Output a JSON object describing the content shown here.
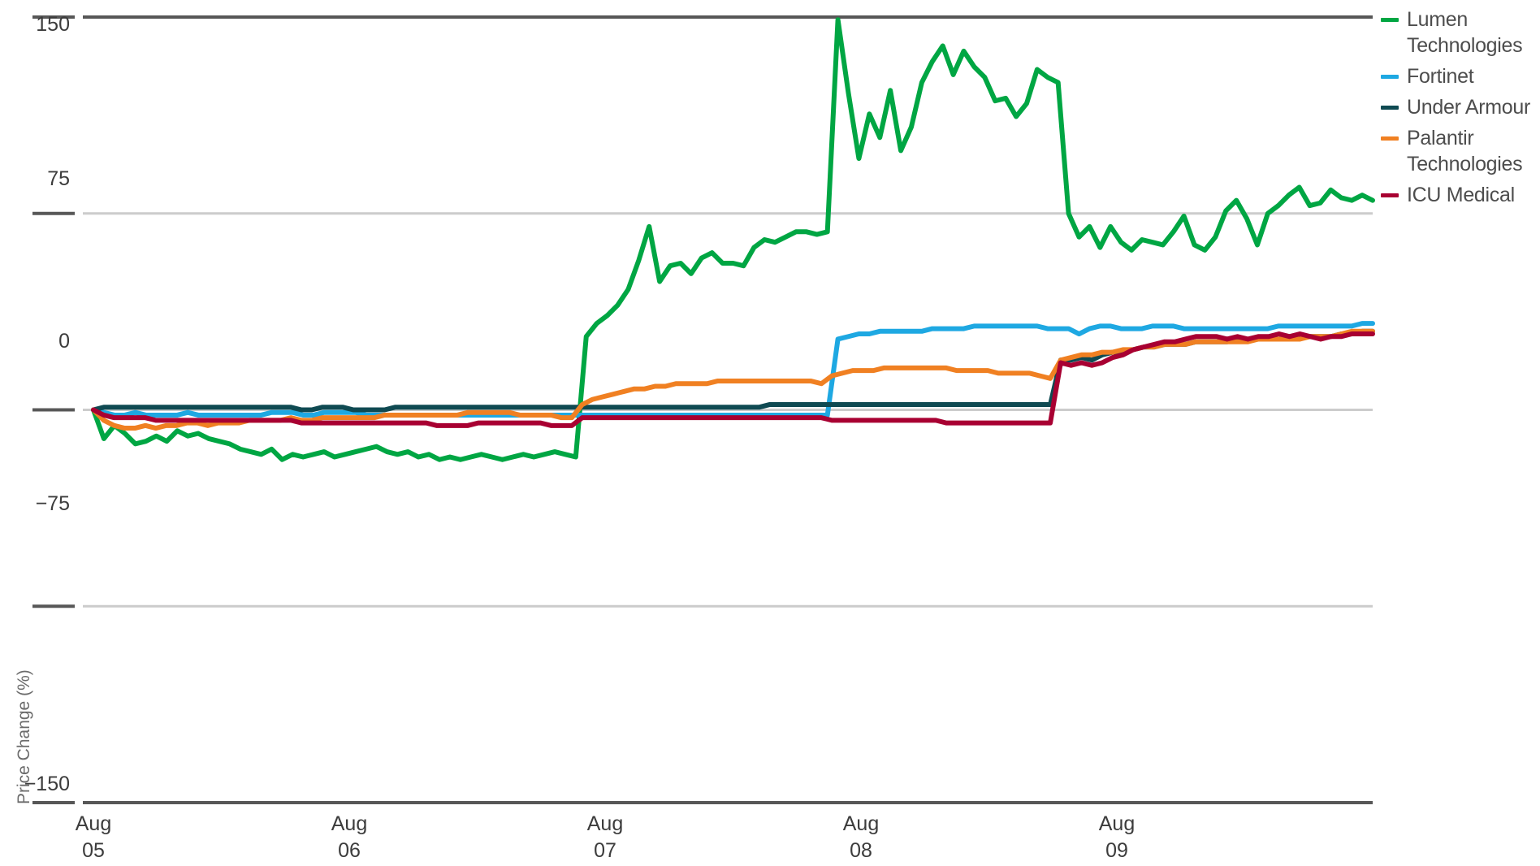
{
  "chart_data": {
    "type": "line",
    "title": "",
    "xlabel": "",
    "ylabel": "Price Change (%)",
    "ylim": [
      -150,
      150
    ],
    "yticks": [
      150,
      75,
      0,
      -75,
      -150
    ],
    "ytick_labels": [
      "150",
      "75",
      "0",
      "−75",
      "−150"
    ],
    "grid": "horizontal-light",
    "legend_position": "right",
    "x_tick_labels": [
      {
        "line1": "Aug",
        "line2": "05"
      },
      {
        "line1": "Aug",
        "line2": "06"
      },
      {
        "line1": "Aug",
        "line2": "07"
      },
      {
        "line1": "Aug",
        "line2": "08"
      },
      {
        "line1": "Aug",
        "line2": "09"
      }
    ],
    "x_start": "Aug 05",
    "x_end": "Aug 09",
    "series": [
      {
        "name": "Lumen Technologies",
        "color": "#00A643",
        "values": [
          0,
          -11,
          -6,
          -9,
          -13,
          -12,
          -10,
          -12,
          -8,
          -10,
          -9,
          -11,
          -12,
          -13,
          -15,
          -16,
          -17,
          -15,
          -19,
          -17,
          -18,
          -17,
          -16,
          -18,
          -17,
          -16,
          -15,
          -14,
          -16,
          -17,
          -16,
          -18,
          -17,
          -19,
          -18,
          -19,
          -18,
          -17,
          -18,
          -19,
          -18,
          -17,
          -18,
          -17,
          -16,
          -17,
          -18,
          28,
          33,
          36,
          40,
          46,
          57,
          70,
          49,
          55,
          56,
          52,
          58,
          60,
          56,
          56,
          55,
          62,
          65,
          64,
          66,
          68,
          68,
          67,
          68,
          149,
          121,
          96,
          113,
          104,
          122,
          99,
          108,
          125,
          133,
          139,
          128,
          137,
          131,
          127,
          118,
          119,
          112,
          117,
          130,
          127,
          125,
          75,
          66,
          70,
          62,
          70,
          64,
          61,
          65,
          64,
          63,
          68,
          74,
          63,
          61,
          66,
          76,
          80,
          73,
          63,
          75,
          78,
          82,
          85,
          78,
          79,
          84,
          81,
          80,
          82,
          80
        ]
      },
      {
        "name": "Fortinet",
        "color": "#1EA8E2",
        "values": [
          0,
          -1,
          -2,
          -2,
          -1,
          -2,
          -2,
          -2,
          -2,
          -1,
          -2,
          -2,
          -2,
          -2,
          -2,
          -2,
          -2,
          -1,
          -1,
          -1,
          -2,
          -2,
          -1,
          -1,
          -1,
          -1,
          -2,
          -2,
          -2,
          -2,
          -2,
          -2,
          -2,
          -2,
          -2,
          -2,
          -2,
          -2,
          -2,
          -2,
          -2,
          -2,
          -2,
          -2,
          -2,
          -2,
          -2,
          -2,
          -2,
          -2,
          -2,
          -2,
          -2,
          -2,
          -2,
          -2,
          -2,
          -2,
          -2,
          -2,
          -2,
          -2,
          -2,
          -2,
          -2,
          -2,
          -2,
          -2,
          -2,
          -2,
          -2,
          27,
          28,
          29,
          29,
          30,
          30,
          30,
          30,
          30,
          31,
          31,
          31,
          31,
          32,
          32,
          32,
          32,
          32,
          32,
          32,
          31,
          31,
          31,
          29,
          31,
          32,
          32,
          31,
          31,
          31,
          32,
          32,
          32,
          31,
          31,
          31,
          31,
          31,
          31,
          31,
          31,
          31,
          32,
          32,
          32,
          32,
          32,
          32,
          32,
          32,
          33,
          33
        ]
      },
      {
        "name": "Under Armour",
        "color": "#0F4A52",
        "values": [
          0,
          1,
          1,
          1,
          1,
          1,
          1,
          1,
          1,
          1,
          1,
          1,
          1,
          1,
          1,
          1,
          1,
          1,
          1,
          1,
          0,
          0,
          1,
          1,
          1,
          0,
          0,
          0,
          0,
          1,
          1,
          1,
          1,
          1,
          1,
          1,
          1,
          1,
          1,
          1,
          1,
          1,
          1,
          1,
          1,
          1,
          1,
          1,
          1,
          1,
          1,
          1,
          1,
          1,
          1,
          1,
          1,
          1,
          1,
          1,
          1,
          1,
          1,
          1,
          1,
          2,
          2,
          2,
          2,
          2,
          2,
          2,
          2,
          2,
          2,
          2,
          2,
          2,
          2,
          2,
          2,
          2,
          2,
          2,
          2,
          2,
          2,
          2,
          2,
          2,
          2,
          2,
          2,
          19,
          19,
          20,
          19,
          21,
          22,
          22,
          23,
          24,
          24,
          25,
          25,
          25,
          26,
          26,
          26,
          26,
          27,
          27,
          27,
          27,
          27,
          28,
          28,
          28,
          28,
          28,
          29,
          29,
          30,
          30
        ]
      },
      {
        "name": "Palantir Technologies",
        "color": "#F08022",
        "values": [
          0,
          -4,
          -6,
          -7,
          -7,
          -6,
          -7,
          -6,
          -6,
          -5,
          -5,
          -6,
          -5,
          -5,
          -5,
          -4,
          -4,
          -4,
          -4,
          -3,
          -4,
          -4,
          -3,
          -3,
          -3,
          -3,
          -3,
          -3,
          -2,
          -2,
          -2,
          -2,
          -2,
          -2,
          -2,
          -2,
          -1,
          -1,
          -1,
          -1,
          -1,
          -2,
          -2,
          -2,
          -2,
          -3,
          -3,
          2,
          4,
          5,
          6,
          7,
          8,
          8,
          9,
          9,
          10,
          10,
          10,
          10,
          11,
          11,
          11,
          11,
          11,
          11,
          11,
          11,
          11,
          11,
          10,
          13,
          14,
          15,
          15,
          15,
          16,
          16,
          16,
          16,
          16,
          16,
          16,
          15,
          15,
          15,
          15,
          14,
          14,
          14,
          14,
          13,
          12,
          19,
          20,
          21,
          21,
          22,
          22,
          23,
          23,
          24,
          24,
          25,
          25,
          25,
          26,
          26,
          26,
          26,
          26,
          26,
          27,
          27,
          27,
          27,
          27,
          28,
          28,
          28,
          29,
          30,
          30,
          30
        ]
      },
      {
        "name": "ICU Medical",
        "color": "#A80032",
        "values": [
          0,
          -2,
          -3,
          -3,
          -3,
          -3,
          -4,
          -4,
          -4,
          -4,
          -4,
          -4,
          -4,
          -4,
          -4,
          -4,
          -4,
          -4,
          -4,
          -4,
          -5,
          -5,
          -5,
          -5,
          -5,
          -5,
          -5,
          -5,
          -5,
          -5,
          -5,
          -5,
          -5,
          -6,
          -6,
          -6,
          -6,
          -5,
          -5,
          -5,
          -5,
          -5,
          -5,
          -5,
          -6,
          -6,
          -6,
          -3,
          -3,
          -3,
          -3,
          -3,
          -3,
          -3,
          -3,
          -3,
          -3,
          -3,
          -3,
          -3,
          -3,
          -3,
          -3,
          -3,
          -3,
          -3,
          -3,
          -3,
          -3,
          -3,
          -3,
          -4,
          -4,
          -4,
          -4,
          -4,
          -4,
          -4,
          -4,
          -4,
          -4,
          -4,
          -5,
          -5,
          -5,
          -5,
          -5,
          -5,
          -5,
          -5,
          -5,
          -5,
          -5,
          18,
          17,
          18,
          17,
          18,
          20,
          21,
          23,
          24,
          25,
          26,
          26,
          27,
          28,
          28,
          28,
          27,
          28,
          27,
          28,
          28,
          29,
          28,
          29,
          28,
          27,
          28,
          28,
          29,
          29,
          29
        ]
      }
    ]
  },
  "legend": {
    "items": [
      {
        "label": "Lumen Technologies",
        "color": "#00A643"
      },
      {
        "label": "Fortinet",
        "color": "#1EA8E2"
      },
      {
        "label": "Under Armour",
        "color": "#0F4A52"
      },
      {
        "label": "Palantir Technologies",
        "color": "#F08022"
      },
      {
        "label": "ICU Medical",
        "color": "#A80032"
      }
    ]
  },
  "axes": {
    "y_title": "Price Change (%)",
    "y_labels": [
      "150",
      "75",
      "0",
      "−75",
      "−150"
    ],
    "x_labels_line1": [
      "Aug",
      "Aug",
      "Aug",
      "Aug",
      "Aug"
    ],
    "x_labels_line2": [
      "05",
      "06",
      "07",
      "08",
      "09"
    ]
  },
  "colors": {
    "axis": "#575757",
    "gridline": "#cccccc",
    "tick_text": "#3c3c3c",
    "legend_text": "#4d4d4d",
    "y_title": "#6b6b6b",
    "background": "#ffffff"
  }
}
